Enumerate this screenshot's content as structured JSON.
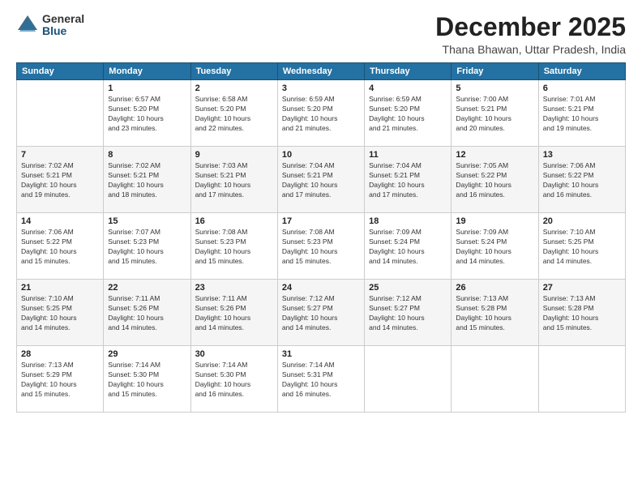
{
  "logo": {
    "general": "General",
    "blue": "Blue"
  },
  "title": "December 2025",
  "location": "Thana Bhawan, Uttar Pradesh, India",
  "headers": [
    "Sunday",
    "Monday",
    "Tuesday",
    "Wednesday",
    "Thursday",
    "Friday",
    "Saturday"
  ],
  "weeks": [
    [
      {
        "day": "",
        "content": ""
      },
      {
        "day": "1",
        "content": "Sunrise: 6:57 AM\nSunset: 5:20 PM\nDaylight: 10 hours\nand 23 minutes."
      },
      {
        "day": "2",
        "content": "Sunrise: 6:58 AM\nSunset: 5:20 PM\nDaylight: 10 hours\nand 22 minutes."
      },
      {
        "day": "3",
        "content": "Sunrise: 6:59 AM\nSunset: 5:20 PM\nDaylight: 10 hours\nand 21 minutes."
      },
      {
        "day": "4",
        "content": "Sunrise: 6:59 AM\nSunset: 5:20 PM\nDaylight: 10 hours\nand 21 minutes."
      },
      {
        "day": "5",
        "content": "Sunrise: 7:00 AM\nSunset: 5:21 PM\nDaylight: 10 hours\nand 20 minutes."
      },
      {
        "day": "6",
        "content": "Sunrise: 7:01 AM\nSunset: 5:21 PM\nDaylight: 10 hours\nand 19 minutes."
      }
    ],
    [
      {
        "day": "7",
        "content": "Sunrise: 7:02 AM\nSunset: 5:21 PM\nDaylight: 10 hours\nand 19 minutes."
      },
      {
        "day": "8",
        "content": "Sunrise: 7:02 AM\nSunset: 5:21 PM\nDaylight: 10 hours\nand 18 minutes."
      },
      {
        "day": "9",
        "content": "Sunrise: 7:03 AM\nSunset: 5:21 PM\nDaylight: 10 hours\nand 17 minutes."
      },
      {
        "day": "10",
        "content": "Sunrise: 7:04 AM\nSunset: 5:21 PM\nDaylight: 10 hours\nand 17 minutes."
      },
      {
        "day": "11",
        "content": "Sunrise: 7:04 AM\nSunset: 5:21 PM\nDaylight: 10 hours\nand 17 minutes."
      },
      {
        "day": "12",
        "content": "Sunrise: 7:05 AM\nSunset: 5:22 PM\nDaylight: 10 hours\nand 16 minutes."
      },
      {
        "day": "13",
        "content": "Sunrise: 7:06 AM\nSunset: 5:22 PM\nDaylight: 10 hours\nand 16 minutes."
      }
    ],
    [
      {
        "day": "14",
        "content": "Sunrise: 7:06 AM\nSunset: 5:22 PM\nDaylight: 10 hours\nand 15 minutes."
      },
      {
        "day": "15",
        "content": "Sunrise: 7:07 AM\nSunset: 5:23 PM\nDaylight: 10 hours\nand 15 minutes."
      },
      {
        "day": "16",
        "content": "Sunrise: 7:08 AM\nSunset: 5:23 PM\nDaylight: 10 hours\nand 15 minutes."
      },
      {
        "day": "17",
        "content": "Sunrise: 7:08 AM\nSunset: 5:23 PM\nDaylight: 10 hours\nand 15 minutes."
      },
      {
        "day": "18",
        "content": "Sunrise: 7:09 AM\nSunset: 5:24 PM\nDaylight: 10 hours\nand 14 minutes."
      },
      {
        "day": "19",
        "content": "Sunrise: 7:09 AM\nSunset: 5:24 PM\nDaylight: 10 hours\nand 14 minutes."
      },
      {
        "day": "20",
        "content": "Sunrise: 7:10 AM\nSunset: 5:25 PM\nDaylight: 10 hours\nand 14 minutes."
      }
    ],
    [
      {
        "day": "21",
        "content": "Sunrise: 7:10 AM\nSunset: 5:25 PM\nDaylight: 10 hours\nand 14 minutes."
      },
      {
        "day": "22",
        "content": "Sunrise: 7:11 AM\nSunset: 5:26 PM\nDaylight: 10 hours\nand 14 minutes."
      },
      {
        "day": "23",
        "content": "Sunrise: 7:11 AM\nSunset: 5:26 PM\nDaylight: 10 hours\nand 14 minutes."
      },
      {
        "day": "24",
        "content": "Sunrise: 7:12 AM\nSunset: 5:27 PM\nDaylight: 10 hours\nand 14 minutes."
      },
      {
        "day": "25",
        "content": "Sunrise: 7:12 AM\nSunset: 5:27 PM\nDaylight: 10 hours\nand 14 minutes."
      },
      {
        "day": "26",
        "content": "Sunrise: 7:13 AM\nSunset: 5:28 PM\nDaylight: 10 hours\nand 15 minutes."
      },
      {
        "day": "27",
        "content": "Sunrise: 7:13 AM\nSunset: 5:28 PM\nDaylight: 10 hours\nand 15 minutes."
      }
    ],
    [
      {
        "day": "28",
        "content": "Sunrise: 7:13 AM\nSunset: 5:29 PM\nDaylight: 10 hours\nand 15 minutes."
      },
      {
        "day": "29",
        "content": "Sunrise: 7:14 AM\nSunset: 5:30 PM\nDaylight: 10 hours\nand 15 minutes."
      },
      {
        "day": "30",
        "content": "Sunrise: 7:14 AM\nSunset: 5:30 PM\nDaylight: 10 hours\nand 16 minutes."
      },
      {
        "day": "31",
        "content": "Sunrise: 7:14 AM\nSunset: 5:31 PM\nDaylight: 10 hours\nand 16 minutes."
      },
      {
        "day": "",
        "content": ""
      },
      {
        "day": "",
        "content": ""
      },
      {
        "day": "",
        "content": ""
      }
    ]
  ]
}
